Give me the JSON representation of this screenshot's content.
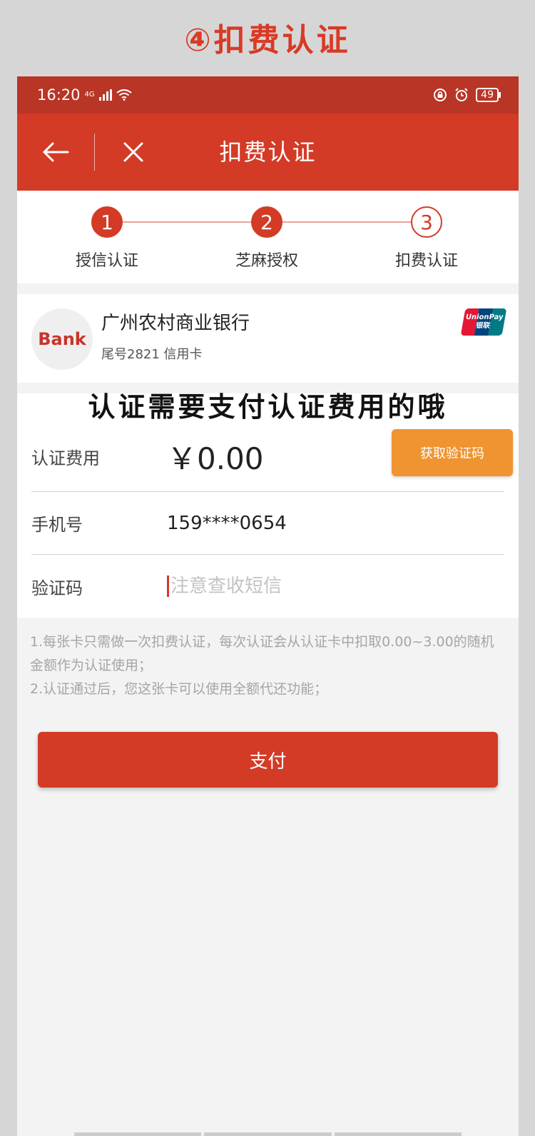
{
  "banner": {
    "title": "④扣费认证"
  },
  "status_bar": {
    "time": "16:20",
    "network": "4G",
    "battery": "49"
  },
  "nav": {
    "back_icon": "arrow-left",
    "close_icon": "close",
    "title": "扣费认证"
  },
  "steps": [
    {
      "number": "1",
      "label": "授信认证",
      "done": true
    },
    {
      "number": "2",
      "label": "芝麻授权",
      "done": true
    },
    {
      "number": "3",
      "label": "扣费认证",
      "done": false
    }
  ],
  "bank_card": {
    "logo_text": "Bank",
    "name": "广州农村商业银行",
    "subtitle": "尾号2821 信用卡",
    "network_logo_line1": "UnionPay",
    "network_logo_line2": "银联"
  },
  "caption": "认证需要支付认证费用的哦",
  "form": {
    "fee_label": "认证费用",
    "fee_value": "￥0.00",
    "phone_label": "手机号",
    "phone_value": "159****0654",
    "code_label": "验证码",
    "code_placeholder": "注意查收短信",
    "code_value": "",
    "get_code_button": "获取验证码"
  },
  "notes": [
    "1.每张卡只需做一次扣费认证，每次认证会从认证卡中扣取0.00~3.00的随机金额作为认证使用；",
    "2.认证通过后，您这张卡可以使用全额代还功能；"
  ],
  "pay_button": "支付",
  "colors": {
    "primary": "#d33b26",
    "status_bar": "#b93525",
    "accent": "#ef9431"
  }
}
